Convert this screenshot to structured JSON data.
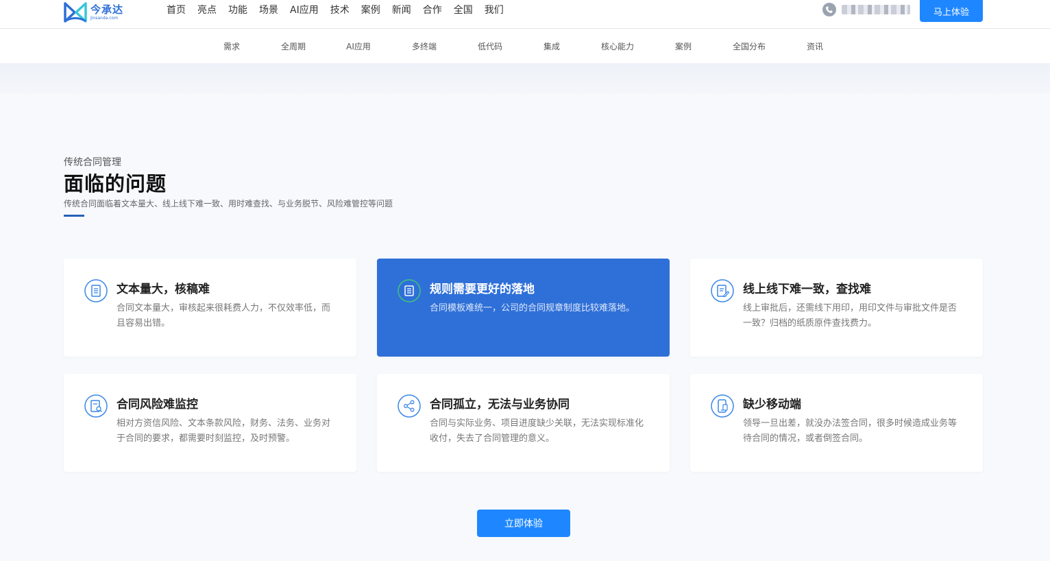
{
  "brand": {
    "name_cn": "今承达",
    "name_en": "Jinsanda.com"
  },
  "main_nav": [
    {
      "label": "首页"
    },
    {
      "label": "亮点"
    },
    {
      "label": "功能"
    },
    {
      "label": "场景"
    },
    {
      "label": "AI应用"
    },
    {
      "label": "技术"
    },
    {
      "label": "案例"
    },
    {
      "label": "新闻"
    },
    {
      "label": "合作"
    },
    {
      "label": "全国"
    },
    {
      "label": "我们"
    }
  ],
  "header": {
    "try_label": "马上体验"
  },
  "sub_nav": [
    {
      "label": "需求"
    },
    {
      "label": "全周期"
    },
    {
      "label": "AI应用"
    },
    {
      "label": "多终端"
    },
    {
      "label": "低代码"
    },
    {
      "label": "集成"
    },
    {
      "label": "核心能力"
    },
    {
      "label": "案例"
    },
    {
      "label": "全国分布"
    },
    {
      "label": "资讯"
    }
  ],
  "section": {
    "subtitle": "传统合同管理",
    "title": "面临的问题",
    "description": "传统合同面临着文本量大、线上线下难一致、用时难查找、与业务脱节、风险难管控等问题"
  },
  "cards": [
    {
      "title": "文本量大，核稿难",
      "text": "合同文本量大，审核起来很耗费人力，不仅效率低，而且容易出错。",
      "icon": "document-icon"
    },
    {
      "title": "规则需要更好的落地",
      "text": "合同模板难统一，公司的合同规章制度比较难落地。",
      "icon": "list-icon"
    },
    {
      "title": "线上线下难一致，查找难",
      "text": "线上审批后，还需线下用印，用印文件与审批文件是否一致？归档的纸质原件查找费力。",
      "icon": "edit-document-icon"
    },
    {
      "title": "合同风险难监控",
      "text": "相对方资信风险、文本条款风险，财务、法务、业务对于合同的要求，都需要时刻监控，及时预警。",
      "icon": "search-document-icon"
    },
    {
      "title": "合同孤立，无法与业务协同",
      "text": "合同与实际业务、项目进度缺少关联，无法实现标准化收付，失去了合同管理的意义。",
      "icon": "share-icon"
    },
    {
      "title": "缺少移动端",
      "text": "领导一旦出差，就没办法签合同，很多时候造成业务等待合同的情况，或者倒签合同。",
      "icon": "mobile-icon"
    }
  ],
  "cta": {
    "label": "立即体验"
  },
  "colors": {
    "primary": "#1e87ff",
    "active_card": "#2f70d8",
    "accent_line": "#2860b8"
  }
}
